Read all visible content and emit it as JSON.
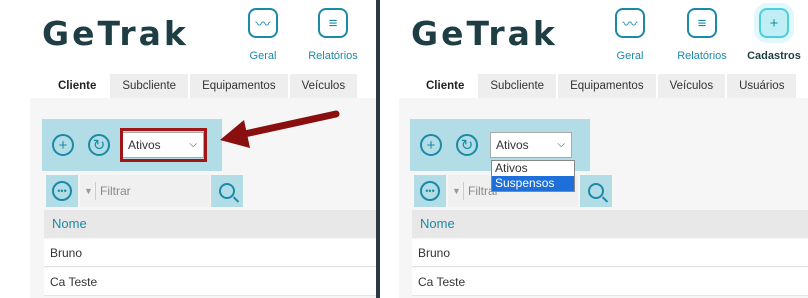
{
  "left": {
    "logo": "GeTrak",
    "nav": [
      {
        "label": "Geral",
        "icon": "chart-monitor-icon"
      },
      {
        "label": "Relatórios",
        "icon": "report-folder-icon"
      }
    ],
    "tabs": [
      "Cliente",
      "Subcliente",
      "Equipamentos",
      "Veículos"
    ],
    "status_select": "Ativos",
    "filter_placeholder": "Filtrar",
    "table_header": "Nome",
    "rows": [
      "Bruno",
      "Ca Teste"
    ]
  },
  "right": {
    "logo": "GeTrak",
    "nav": [
      {
        "label": "Geral",
        "icon": "chart-monitor-icon"
      },
      {
        "label": "Relatórios",
        "icon": "report-folder-icon"
      },
      {
        "label": "Cadastros",
        "icon": "add-folder-icon"
      }
    ],
    "tabs": [
      "Cliente",
      "Subcliente",
      "Equipamentos",
      "Veículos",
      "Usuários"
    ],
    "status_select": "Ativos",
    "dropdown_options": [
      "Ativos",
      "Suspensos"
    ],
    "filter_placeholder": "Filtrar",
    "table_header": "Nome",
    "rows": [
      "Bruno",
      "Ca Teste"
    ]
  },
  "colors": {
    "accent": "#1b8aa6",
    "toolbar": "#b3dde6",
    "highlight": "#a01515",
    "logo": "#1f3e44"
  }
}
